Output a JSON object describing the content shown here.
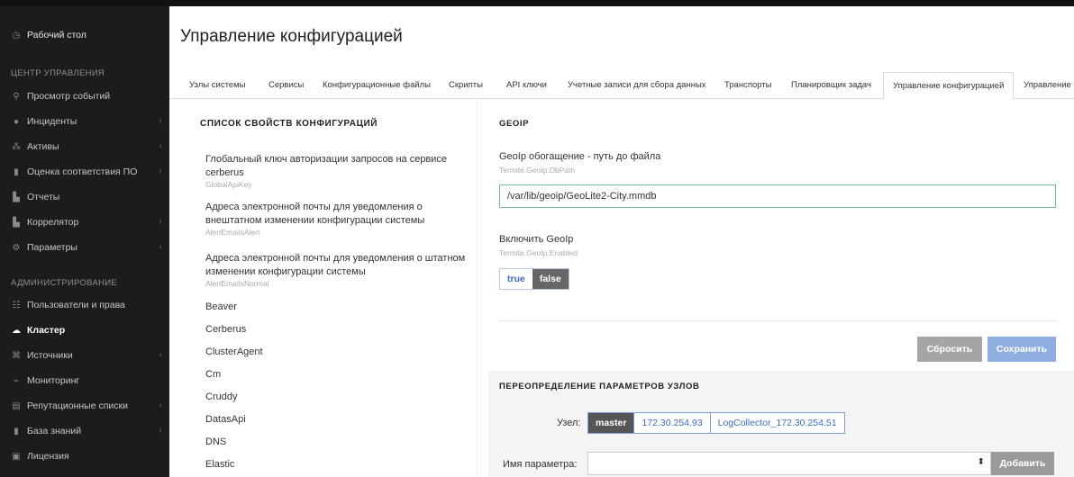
{
  "sidebar": {
    "dashboard": "Рабочий стол",
    "section_control": "ЦЕНТР УПРАВЛЕНИЯ",
    "items_control": [
      {
        "label": "Просмотр событий",
        "icon": "search-icon",
        "chev": false
      },
      {
        "label": "Инциденты",
        "icon": "alert-icon",
        "chev": true
      },
      {
        "label": "Активы",
        "icon": "sitemap-icon",
        "chev": true
      },
      {
        "label": "Оценка соответствия ПО",
        "icon": "document-icon",
        "chev": true
      },
      {
        "label": "Отчеты",
        "icon": "chart-icon",
        "chev": false
      },
      {
        "label": "Коррелятор",
        "icon": "correlator-icon",
        "chev": true
      },
      {
        "label": "Параметры",
        "icon": "gears-icon",
        "chev": true
      }
    ],
    "section_admin": "АДМИНИСТРИРОВАНИЕ",
    "items_admin": [
      {
        "label": "Пользователи и права",
        "icon": "users-icon",
        "chev": false
      },
      {
        "label": "Кластер",
        "icon": "cloud-icon",
        "chev": false,
        "active": true
      },
      {
        "label": "Источники",
        "icon": "sources-icon",
        "chev": true
      },
      {
        "label": "Мониторинг",
        "icon": "monitor-icon",
        "chev": false
      },
      {
        "label": "Репутационные списки",
        "icon": "list-icon",
        "chev": true
      },
      {
        "label": "База знаний",
        "icon": "book-icon",
        "chev": true
      },
      {
        "label": "Лицензия",
        "icon": "license-icon",
        "chev": false
      }
    ]
  },
  "page": {
    "title": "Управление конфигурацией"
  },
  "tabs": [
    {
      "label": "Узлы системы"
    },
    {
      "label": "Сервисы"
    },
    {
      "label": "Конфигурационные файлы"
    },
    {
      "label": "Скрипты"
    },
    {
      "label": "API ключи"
    },
    {
      "label": "Учетные записи для сбора данных"
    },
    {
      "label": "Транспорты"
    },
    {
      "label": "Планировщик задач"
    },
    {
      "label": "Управление конфигурацией",
      "active": true
    },
    {
      "label": "Управление п"
    }
  ],
  "left": {
    "title": "СПИСОК СВОЙСТВ КОНФИГУРАЦИЙ",
    "props": [
      {
        "title": "Глобальный ключ авторизации запросов на сервисе cerberus",
        "key": "GlobalApiKey"
      },
      {
        "title": "Адреса электронной почты для уведомления о внештатном изменении конфигурации системы",
        "key": "AlertEmailsAlert"
      },
      {
        "title": "Адреса электронной почты для уведомления о штатном изменении конфигурации системы",
        "key": "AlertEmailsNormal"
      }
    ],
    "groups": [
      "Beaver",
      "Cerberus",
      "ClusterAgent",
      "Cm",
      "Cruddy",
      "DatasApi",
      "DNS",
      "Elastic"
    ]
  },
  "right": {
    "section": "GEOIP",
    "field1": {
      "label": "GeoIp обогащение - путь до файла",
      "key": "Termite.GeoIp.DbPath",
      "value": "/var/lib/geoip/GeoLite2-City.mmdb"
    },
    "field2": {
      "label": "Включить GeoIp",
      "key": "Termite.GeoIp.Enabled",
      "opt_true": "true",
      "opt_false": "false",
      "selected": "false"
    },
    "reset": "Сбросить",
    "save": "Сохранить"
  },
  "override": {
    "title": "ПЕРЕОПРЕДЕЛЕНИЕ ПАРАМЕТРОВ УЗЛОВ",
    "node_label": "Узел:",
    "nodes": [
      "master",
      "172.30.254.93",
      "LogCollector_172.30.254.51"
    ],
    "param_label": "Имя параметра:",
    "add": "Добавить"
  }
}
